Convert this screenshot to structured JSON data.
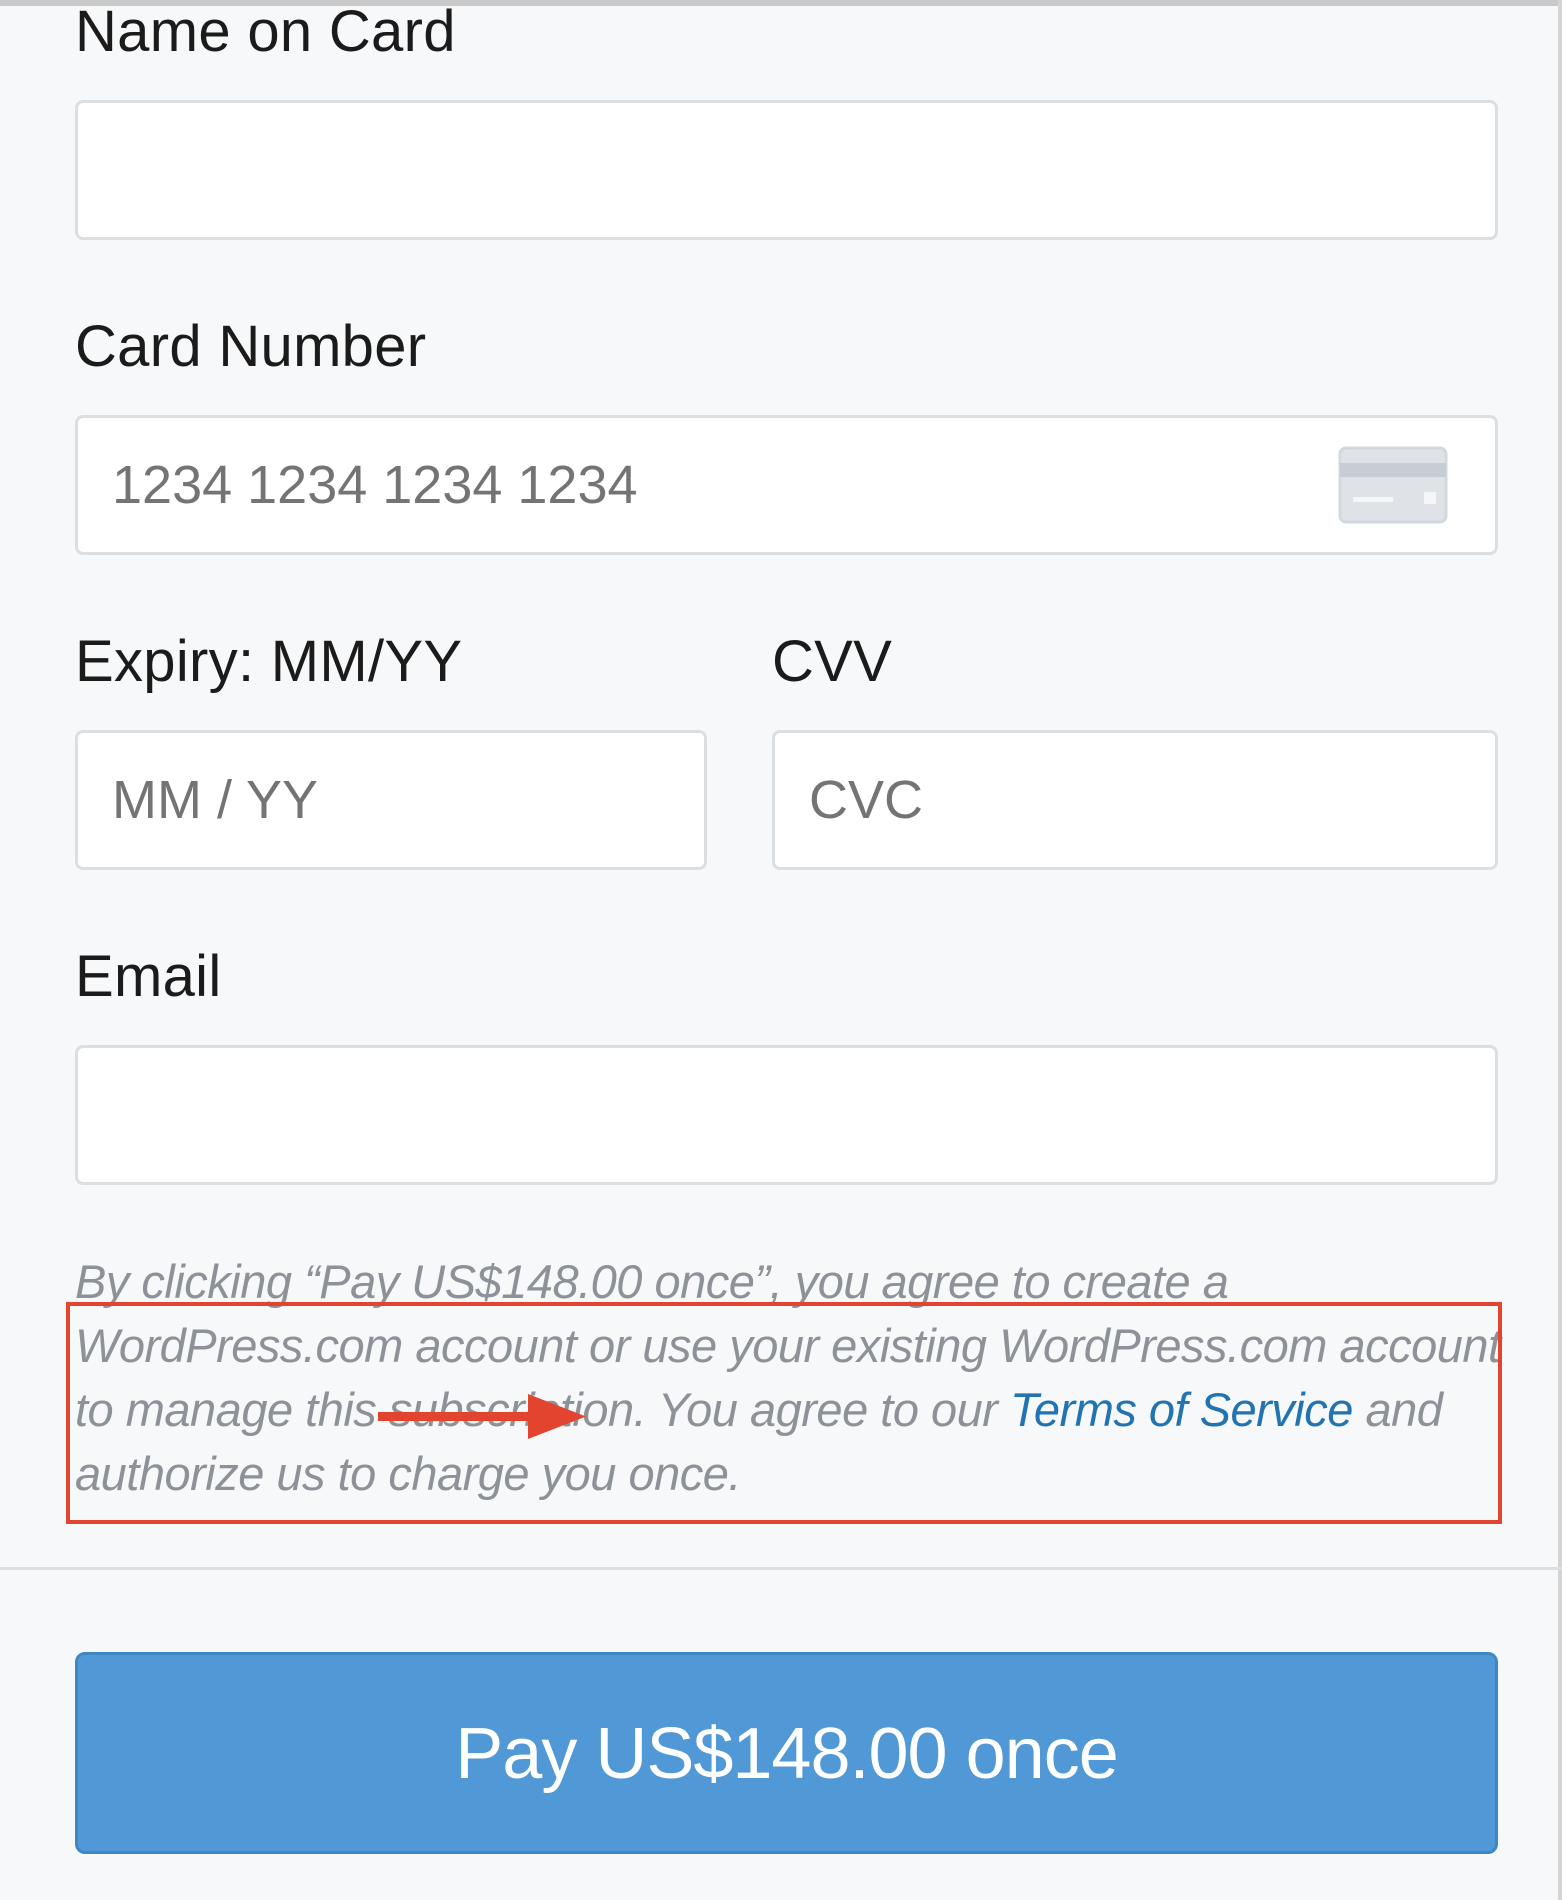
{
  "form": {
    "name_on_card": {
      "label": "Name on Card",
      "value": "",
      "placeholder": ""
    },
    "card_number": {
      "label": "Card Number",
      "value": "",
      "placeholder": "1234 1234 1234 1234",
      "icon": "credit-card-icon"
    },
    "expiry": {
      "label": "Expiry: MM/YY",
      "value": "",
      "placeholder": "MM / YY"
    },
    "cvv": {
      "label": "CVV",
      "value": "",
      "placeholder": "CVC"
    },
    "email": {
      "label": "Email",
      "value": "",
      "placeholder": ""
    }
  },
  "legal": {
    "text_before_link": "By clicking “Pay US$148.00 once”, you agree to create a WordPress.com account or use your existing WordPress.com account to manage this subscription. You agree to our ",
    "link_text": "Terms of Service",
    "text_after_link": " and authorize us to charge you once."
  },
  "pay_button": {
    "label": "Pay US$148.00 once",
    "color": "#5098d6"
  },
  "annotation": {
    "color": "#e3442f",
    "icon": "arrow-right-icon"
  }
}
